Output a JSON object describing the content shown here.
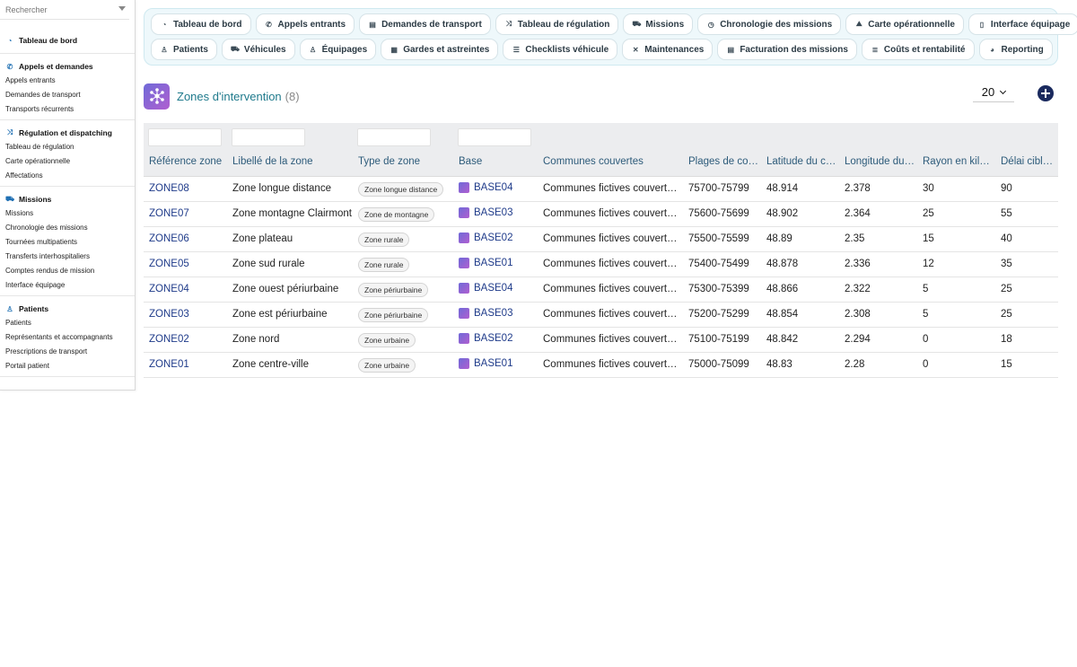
{
  "search": {
    "placeholder": "Rechercher"
  },
  "sidebar": {
    "sections": [
      {
        "title": "Tableau de bord",
        "icon": "gauge-icon",
        "items": []
      },
      {
        "title": "Appels et demandes",
        "icon": "phone-icon",
        "items": [
          "Appels entrants",
          "Demandes de transport",
          "Transports récurrents"
        ]
      },
      {
        "title": "Régulation et dispatching",
        "icon": "shuffle-icon",
        "items": [
          "Tableau de régulation",
          "Carte opérationnelle",
          "Affectations"
        ]
      },
      {
        "title": "Missions",
        "icon": "truck-icon",
        "items": [
          "Missions",
          "Chronologie des missions",
          "Tournées multipatients",
          "Transferts interhospitaliers",
          "Comptes rendus de mission",
          "Interface équipage"
        ]
      },
      {
        "title": "Patients",
        "icon": "person-icon",
        "items": [
          "Patients",
          "Représentants et accompagnants",
          "Prescriptions de transport",
          "Portail patient"
        ]
      }
    ]
  },
  "topnav": {
    "row1": [
      {
        "label": "Tableau de bord",
        "icon": "gauge-icon",
        "glyph": "◔"
      },
      {
        "label": "Appels entrants",
        "icon": "phone-icon",
        "glyph": "✆"
      },
      {
        "label": "Demandes de transport",
        "icon": "clipboard-icon",
        "glyph": "▤"
      },
      {
        "label": "Tableau de régulation",
        "icon": "shuffle-icon",
        "glyph": "⤨"
      },
      {
        "label": "Missions",
        "icon": "truck-icon",
        "glyph": "⛟"
      },
      {
        "label": "Chronologie des missions",
        "icon": "stopwatch-icon",
        "glyph": "◷"
      },
      {
        "label": "Carte opérationnelle",
        "icon": "map-icon",
        "glyph": "⛰"
      },
      {
        "label": "Interface équipage",
        "icon": "mobile-icon",
        "glyph": "▯"
      }
    ],
    "row2": [
      {
        "label": "Patients",
        "icon": "person-icon",
        "glyph": "♙"
      },
      {
        "label": "Véhicules",
        "icon": "truck-icon",
        "glyph": "⛟"
      },
      {
        "label": "Équipages",
        "icon": "user-icon",
        "glyph": "♙"
      },
      {
        "label": "Gardes et astreintes",
        "icon": "calendar-icon",
        "glyph": "▦"
      },
      {
        "label": "Checklists véhicule",
        "icon": "list-icon",
        "glyph": "☰"
      },
      {
        "label": "Maintenances",
        "icon": "wrench-icon",
        "glyph": "✕"
      },
      {
        "label": "Facturation des missions",
        "icon": "invoice-icon",
        "glyph": "▤"
      },
      {
        "label": "Coûts et rentabilité",
        "icon": "coins-icon",
        "glyph": "≣"
      },
      {
        "label": "Reporting",
        "icon": "pie-chart-icon",
        "glyph": "◕"
      }
    ]
  },
  "page": {
    "title": "Zones d'intervention",
    "count": "(8)",
    "page_size": "20"
  },
  "table": {
    "columns": [
      "Référence zone",
      "Libellé de la zone",
      "Type de zone",
      "Base",
      "Communes couvertes",
      "Plages de co…",
      "Latitude du c…",
      "Longitude du…",
      "Rayon en kil…",
      "Délai cible e…"
    ],
    "rows": [
      {
        "ref": "ZONE08",
        "label": "Zone longue distance",
        "type": "Zone longue distance",
        "base": "BASE04",
        "communes": "Communes fictives couverte…",
        "plages": "75700-75799",
        "lat": "48.914",
        "lon": "2.378",
        "rayon": "30",
        "delai": "90"
      },
      {
        "ref": "ZONE07",
        "label": "Zone montagne Clairmont",
        "type": "Zone de montagne",
        "base": "BASE03",
        "communes": "Communes fictives couverte…",
        "plages": "75600-75699",
        "lat": "48.902",
        "lon": "2.364",
        "rayon": "25",
        "delai": "55"
      },
      {
        "ref": "ZONE06",
        "label": "Zone plateau",
        "type": "Zone rurale",
        "base": "BASE02",
        "communes": "Communes fictives couverte…",
        "plages": "75500-75599",
        "lat": "48.89",
        "lon": "2.35",
        "rayon": "15",
        "delai": "40"
      },
      {
        "ref": "ZONE05",
        "label": "Zone sud rurale",
        "type": "Zone rurale",
        "base": "BASE01",
        "communes": "Communes fictives couverte…",
        "plages": "75400-75499",
        "lat": "48.878",
        "lon": "2.336",
        "rayon": "12",
        "delai": "35"
      },
      {
        "ref": "ZONE04",
        "label": "Zone ouest périurbaine",
        "type": "Zone périurbaine",
        "base": "BASE04",
        "communes": "Communes fictives couverte…",
        "plages": "75300-75399",
        "lat": "48.866",
        "lon": "2.322",
        "rayon": "5",
        "delai": "25"
      },
      {
        "ref": "ZONE03",
        "label": "Zone est périurbaine",
        "type": "Zone périurbaine",
        "base": "BASE03",
        "communes": "Communes fictives couverte…",
        "plages": "75200-75299",
        "lat": "48.854",
        "lon": "2.308",
        "rayon": "5",
        "delai": "25"
      },
      {
        "ref": "ZONE02",
        "label": "Zone nord",
        "type": "Zone urbaine",
        "base": "BASE02",
        "communes": "Communes fictives couverte…",
        "plages": "75100-75199",
        "lat": "48.842",
        "lon": "2.294",
        "rayon": "0",
        "delai": "18"
      },
      {
        "ref": "ZONE01",
        "label": "Zone centre-ville",
        "type": "Zone urbaine",
        "base": "BASE01",
        "communes": "Communes fictives couverte…",
        "plages": "75000-75099",
        "lat": "48.83",
        "lon": "2.28",
        "rayon": "0",
        "delai": "15"
      }
    ]
  }
}
